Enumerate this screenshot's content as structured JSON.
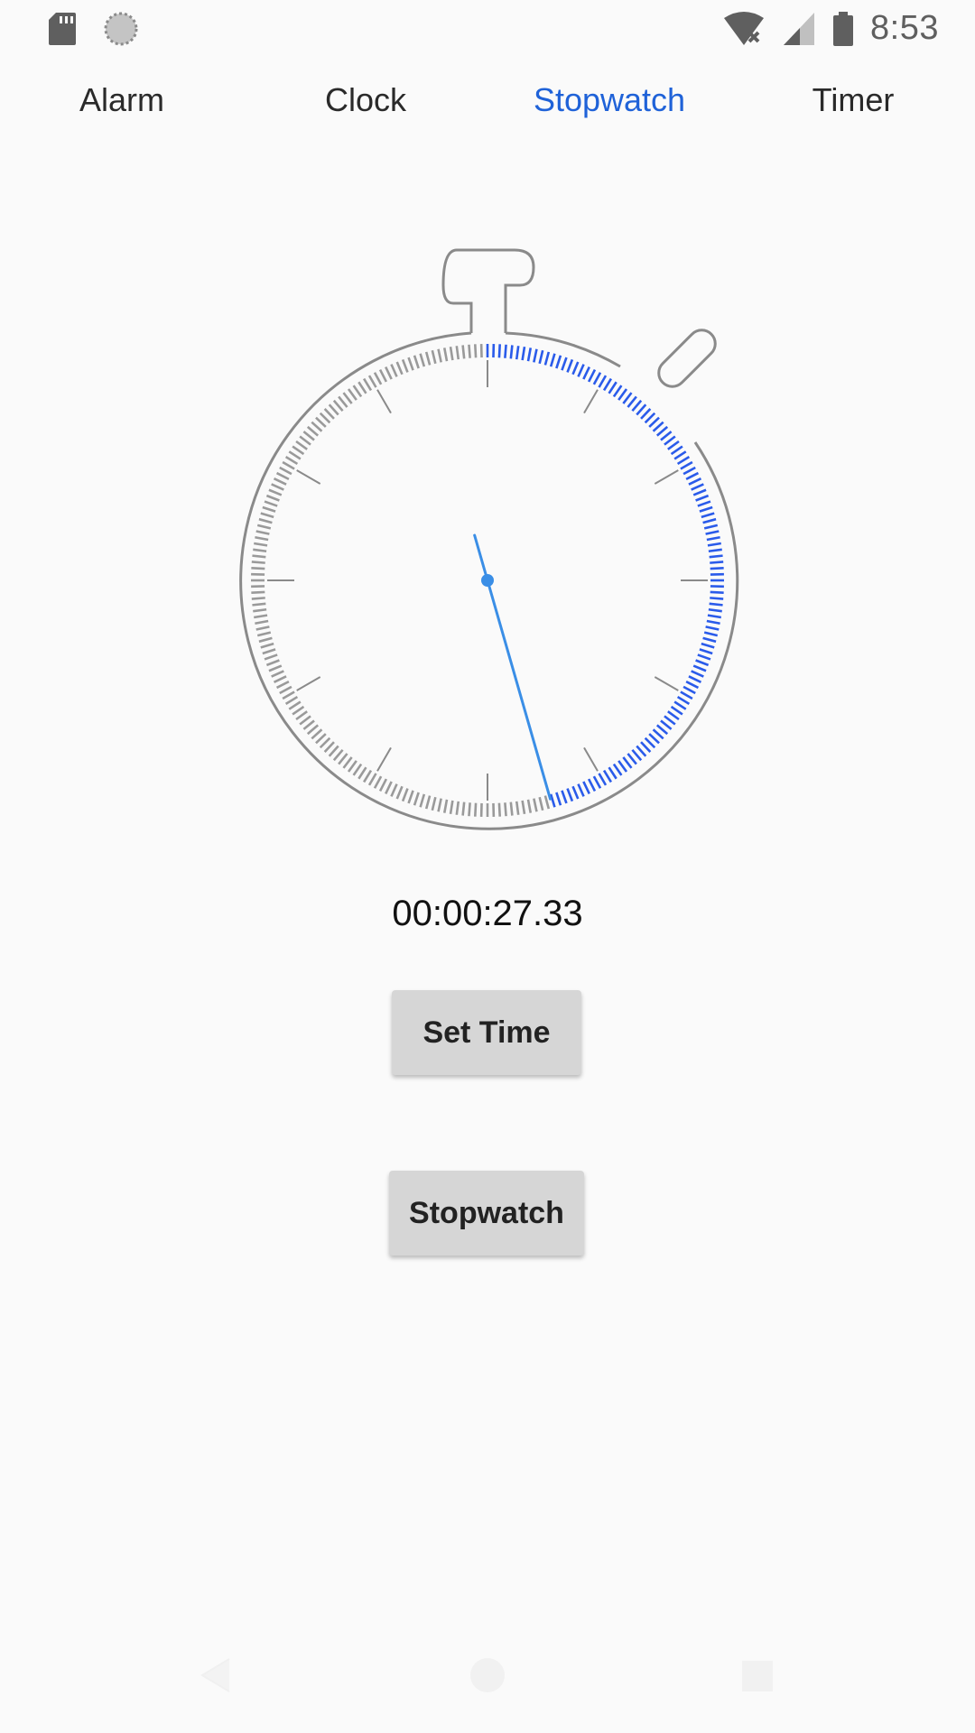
{
  "status_bar": {
    "time": "8:53",
    "left_icons": [
      "sd-card-icon",
      "sync-icon"
    ],
    "right_icons": [
      "wifi-off-icon",
      "signal-icon",
      "battery-icon"
    ]
  },
  "tabs": [
    {
      "label": "Alarm",
      "active": false
    },
    {
      "label": "Clock",
      "active": false
    },
    {
      "label": "Stopwatch",
      "active": true
    },
    {
      "label": "Timer",
      "active": false
    }
  ],
  "stopwatch": {
    "elapsed": "00:00:27.33",
    "elapsed_seconds": 27.33,
    "progress_color": "#2a5bea",
    "hand_color": "#3a8ee6"
  },
  "buttons": {
    "set_time_label": "Set Time",
    "stopwatch_label": "Stopwatch"
  },
  "navigation": [
    "back-icon",
    "home-icon",
    "recents-icon"
  ]
}
